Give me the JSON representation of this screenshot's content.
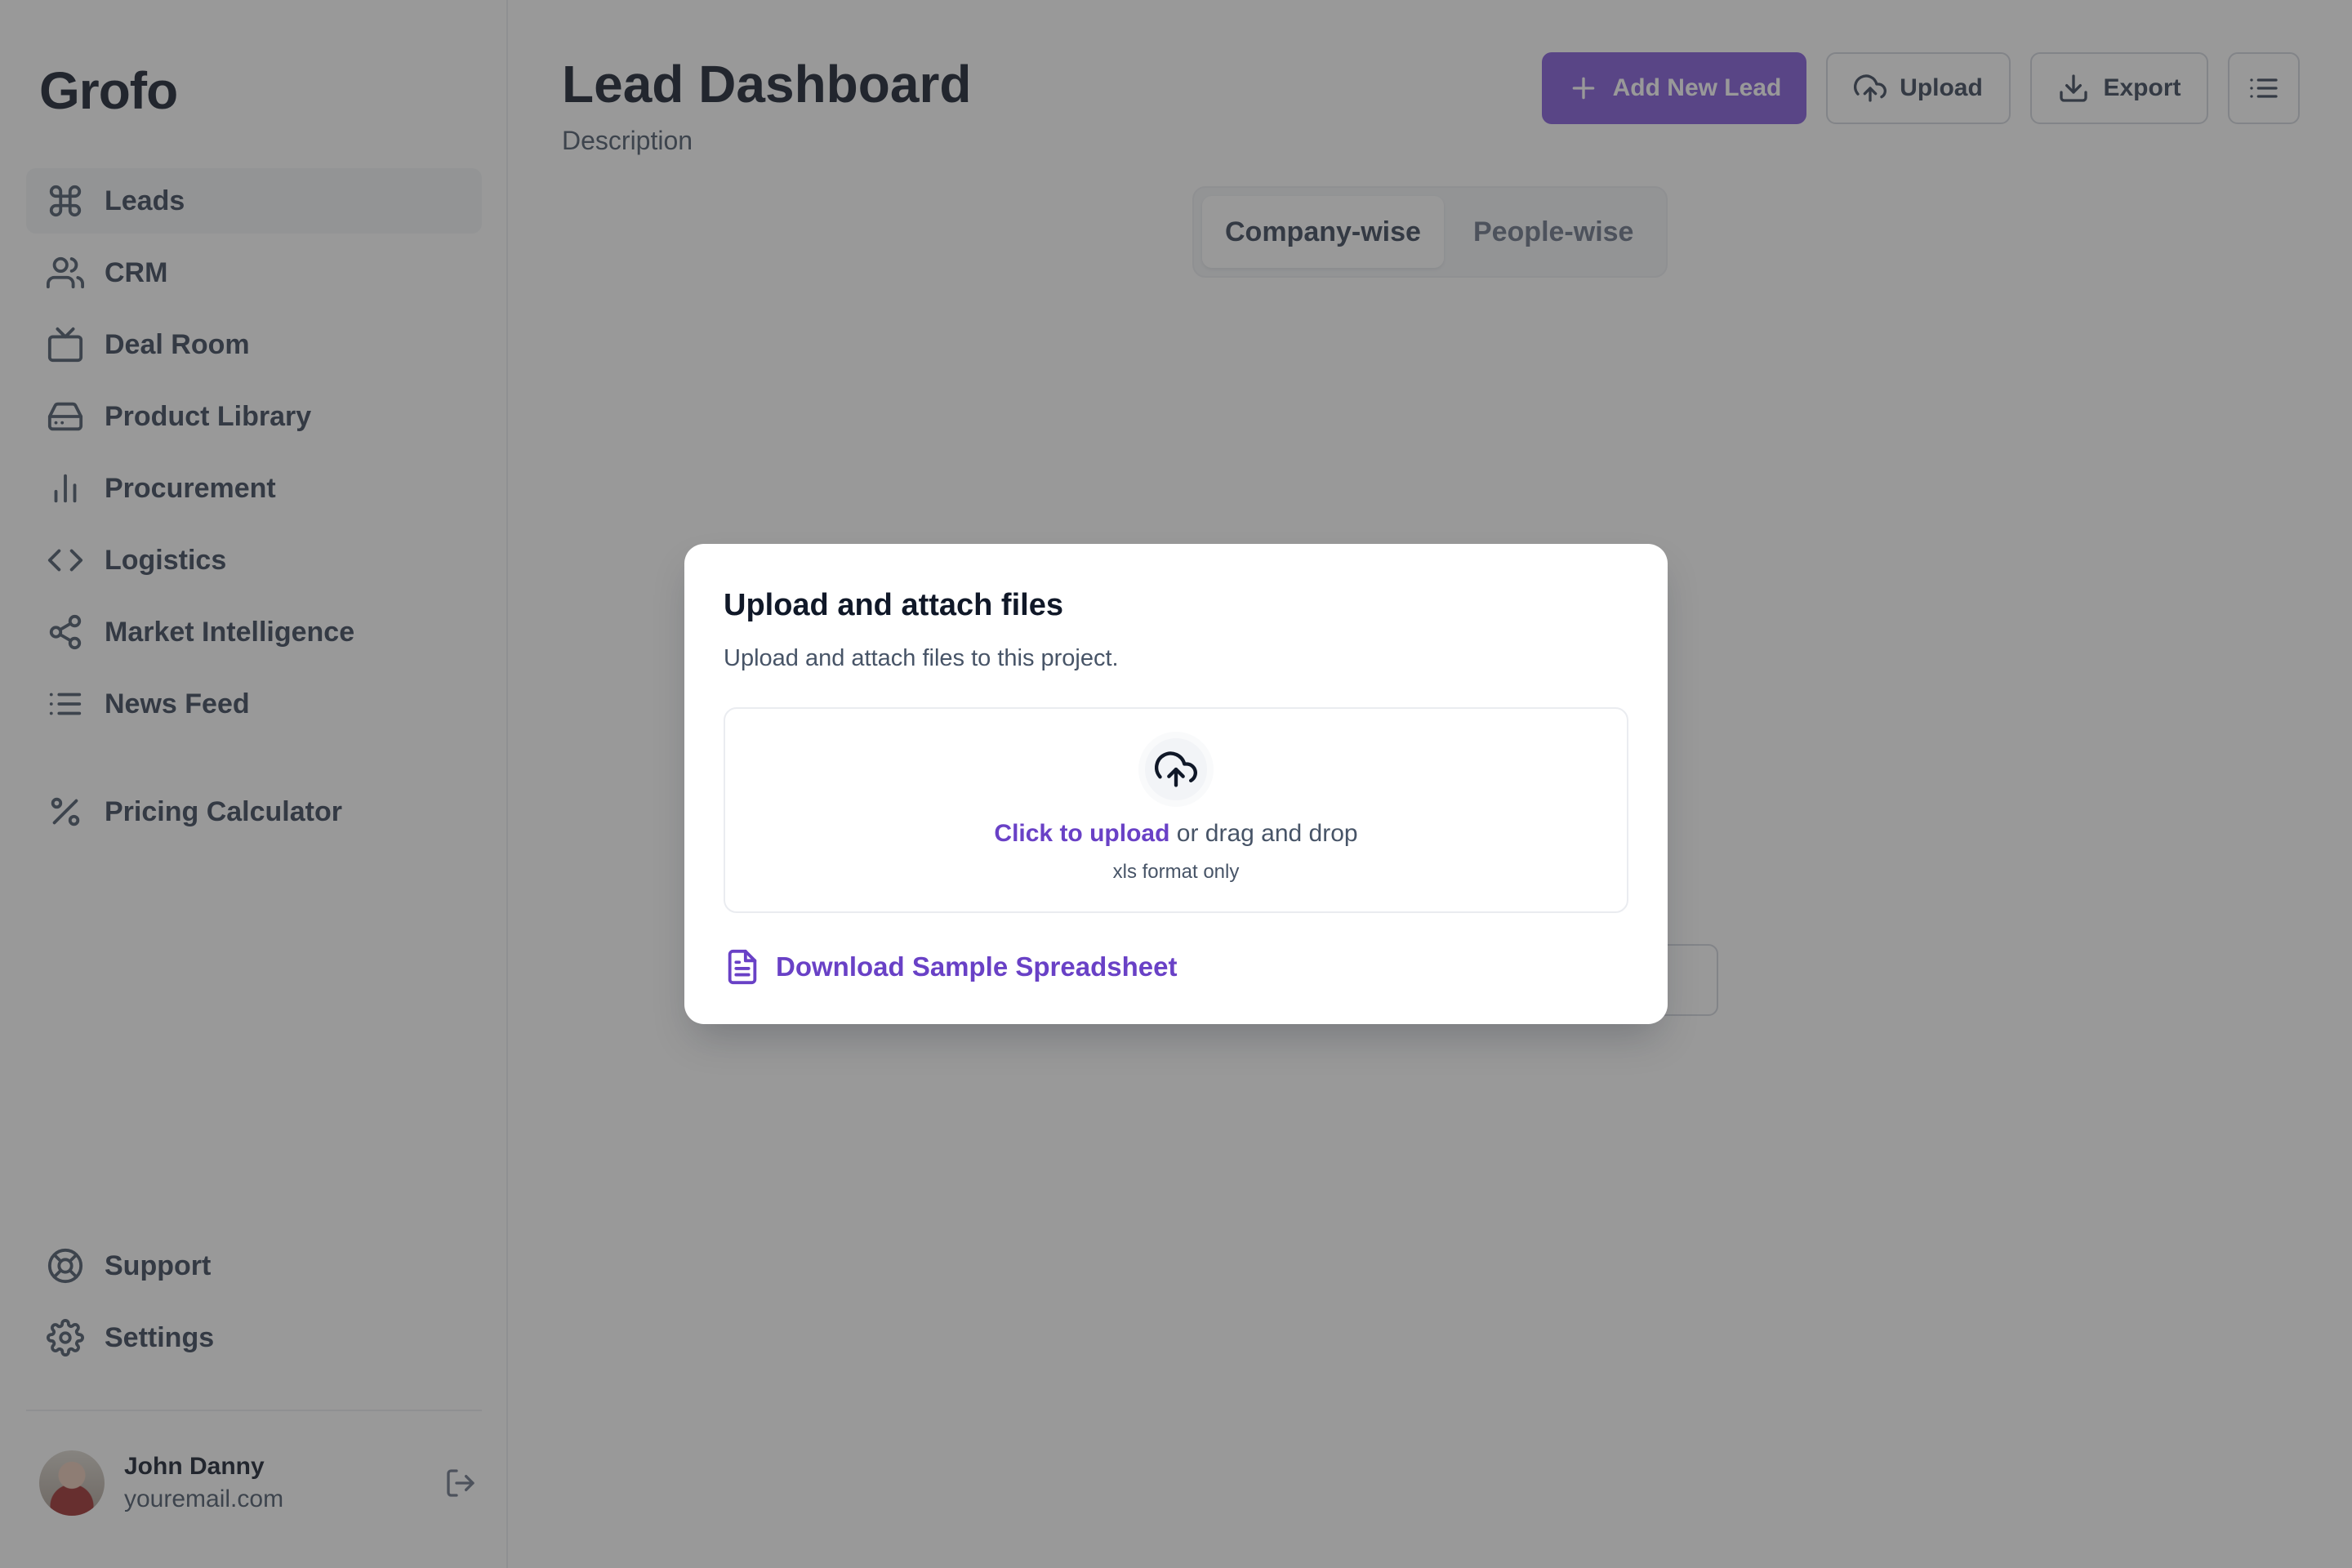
{
  "app": {
    "logo": "Grofo"
  },
  "sidebar": {
    "items": [
      {
        "label": "Leads",
        "icon": "command-icon",
        "active": true
      },
      {
        "label": "CRM",
        "icon": "users-icon"
      },
      {
        "label": "Deal Room",
        "icon": "tv-icon"
      },
      {
        "label": "Product Library",
        "icon": "hard-drive-icon"
      },
      {
        "label": "Procurement",
        "icon": "bar-chart-icon"
      },
      {
        "label": "Logistics",
        "icon": "code-icon"
      },
      {
        "label": "Market Intelligence",
        "icon": "share-icon"
      },
      {
        "label": "News Feed",
        "icon": "list-icon"
      },
      {
        "label": "Pricing Calculator",
        "icon": "percent-icon"
      }
    ],
    "bottom": [
      {
        "label": "Support",
        "icon": "life-buoy-icon"
      },
      {
        "label": "Settings",
        "icon": "gear-icon"
      }
    ],
    "user": {
      "name": "John Danny",
      "email": "youremail.com"
    }
  },
  "header": {
    "title": "Lead Dashboard",
    "description": "Description",
    "add_label": "Add New Lead",
    "upload_label": "Upload",
    "export_label": "Export"
  },
  "tabs": [
    {
      "label": "Company-wise",
      "active": true
    },
    {
      "label": "People-wise",
      "active": false
    }
  ],
  "modal": {
    "title": "Upload and attach files",
    "subtitle": "Upload and attach files to this project.",
    "click_upload": "Click to upload",
    "drag_drop": " or drag and drop",
    "format_hint": "xls format only",
    "download_label": "Download Sample Spreadsheet"
  },
  "colors": {
    "accent": "#7f56d9",
    "link": "#6941c6",
    "overlay": "#343434"
  }
}
